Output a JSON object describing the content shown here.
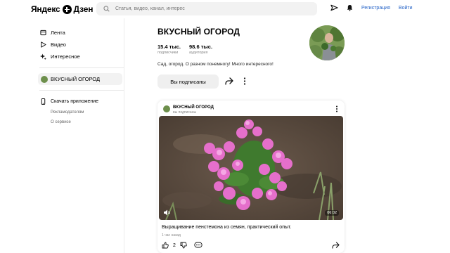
{
  "header": {
    "logo_text": "Яндекс",
    "logo_text2": "Дзен",
    "search_placeholder": "Статья, видео, канал, интерес",
    "register_label": "Регистрация",
    "login_label": "Войти"
  },
  "sidebar": {
    "items": [
      {
        "label": "Лента",
        "icon": "feed-icon"
      },
      {
        "label": "Видео",
        "icon": "play-icon"
      },
      {
        "label": "Интересное",
        "icon": "sparkle-icon"
      }
    ],
    "channel_label": "ВКУСНЫЙ ОГОРОД",
    "download_label": "Скачать приложение",
    "ads_label": "Рекламодателям",
    "about_label": "О сервисе"
  },
  "channel": {
    "title": "ВКУСНЫЙ ОГОРОД",
    "subscribers": "15.4 тыс.",
    "subscribers_caption": "подписчики",
    "audience": "98.6 тыс.",
    "audience_caption": "аудитория",
    "description": "Сад, огород. О разном понемногу! Много интересного!",
    "subscribed_label": "Вы подписаны"
  },
  "card": {
    "channel_name": "ВКУСНЫЙ ОГОРОД",
    "channel_sub": "вы подписаны",
    "duration": "06:02",
    "title": "Выращивание пенстемона из семян, практический опыт.",
    "time": "1 час назад",
    "likes": "2"
  },
  "colors": {
    "accent": "#2563c7",
    "flower": "#e86fd0",
    "soil": "#5a4a3e"
  }
}
